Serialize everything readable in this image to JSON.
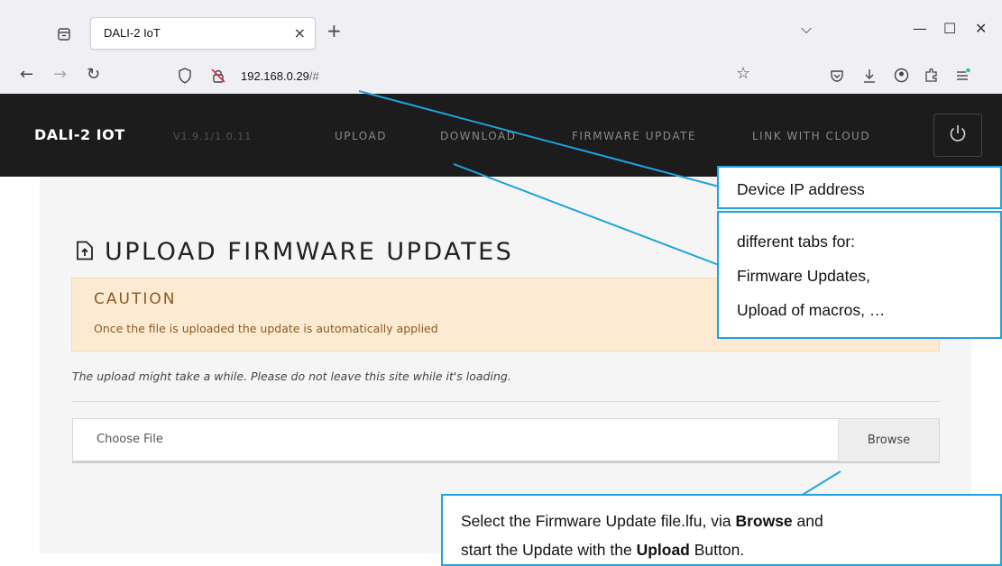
{
  "browser": {
    "tab_title": "DALI-2 IoT",
    "tab_close": "×",
    "new_tab": "+",
    "url_host": "192.168.0.29",
    "url_hash": "/#",
    "window_controls": {
      "dropdown": "⌵",
      "minimize": "—",
      "maximize": "☐",
      "close": "✕"
    }
  },
  "app": {
    "brand": "DALI-2 IOT",
    "version": "V1.9.1/1.0.11",
    "menu": [
      "UPLOAD",
      "DOWNLOAD",
      "FIRMWARE UPDATE",
      "LINK WITH CLOUD"
    ]
  },
  "page": {
    "title": "UPLOAD FIRMWARE UPDATES",
    "caution_title": "CAUTION",
    "caution_text": "Once the file is uploaded the update is automatically applied",
    "info_text": "The upload might take a while. Please do not leave this site while it's loading.",
    "file_placeholder": "Choose File",
    "browse_label": "Browse"
  },
  "callouts": {
    "ip": "Device IP address",
    "tabs_line1": "different tabs for:",
    "tabs_line2": "Firmware Updates,",
    "tabs_line3": "Upload of macros, …",
    "file_l1_a": "Select the Firmware Update file.lfu, via ",
    "file_l1_b": "Browse",
    "file_l1_c": " and",
    "file_l2_a": "start the Update with the ",
    "file_l2_b": "Upload",
    "file_l2_c": " Button."
  },
  "colors": {
    "app_bar": "#1c1c1c",
    "caution_bg": "#fcebd2",
    "caution_text": "#8a5a22",
    "callout_border": "#1fa3dc"
  },
  "icons": [
    "tab-list-icon",
    "back-icon",
    "forward-icon",
    "reload-icon",
    "shield-icon",
    "insecure-lock-icon",
    "star-icon",
    "pocket-icon",
    "download-icon",
    "account-icon",
    "extensions-icon",
    "menu-icon",
    "power-icon",
    "upload-file-icon"
  ]
}
